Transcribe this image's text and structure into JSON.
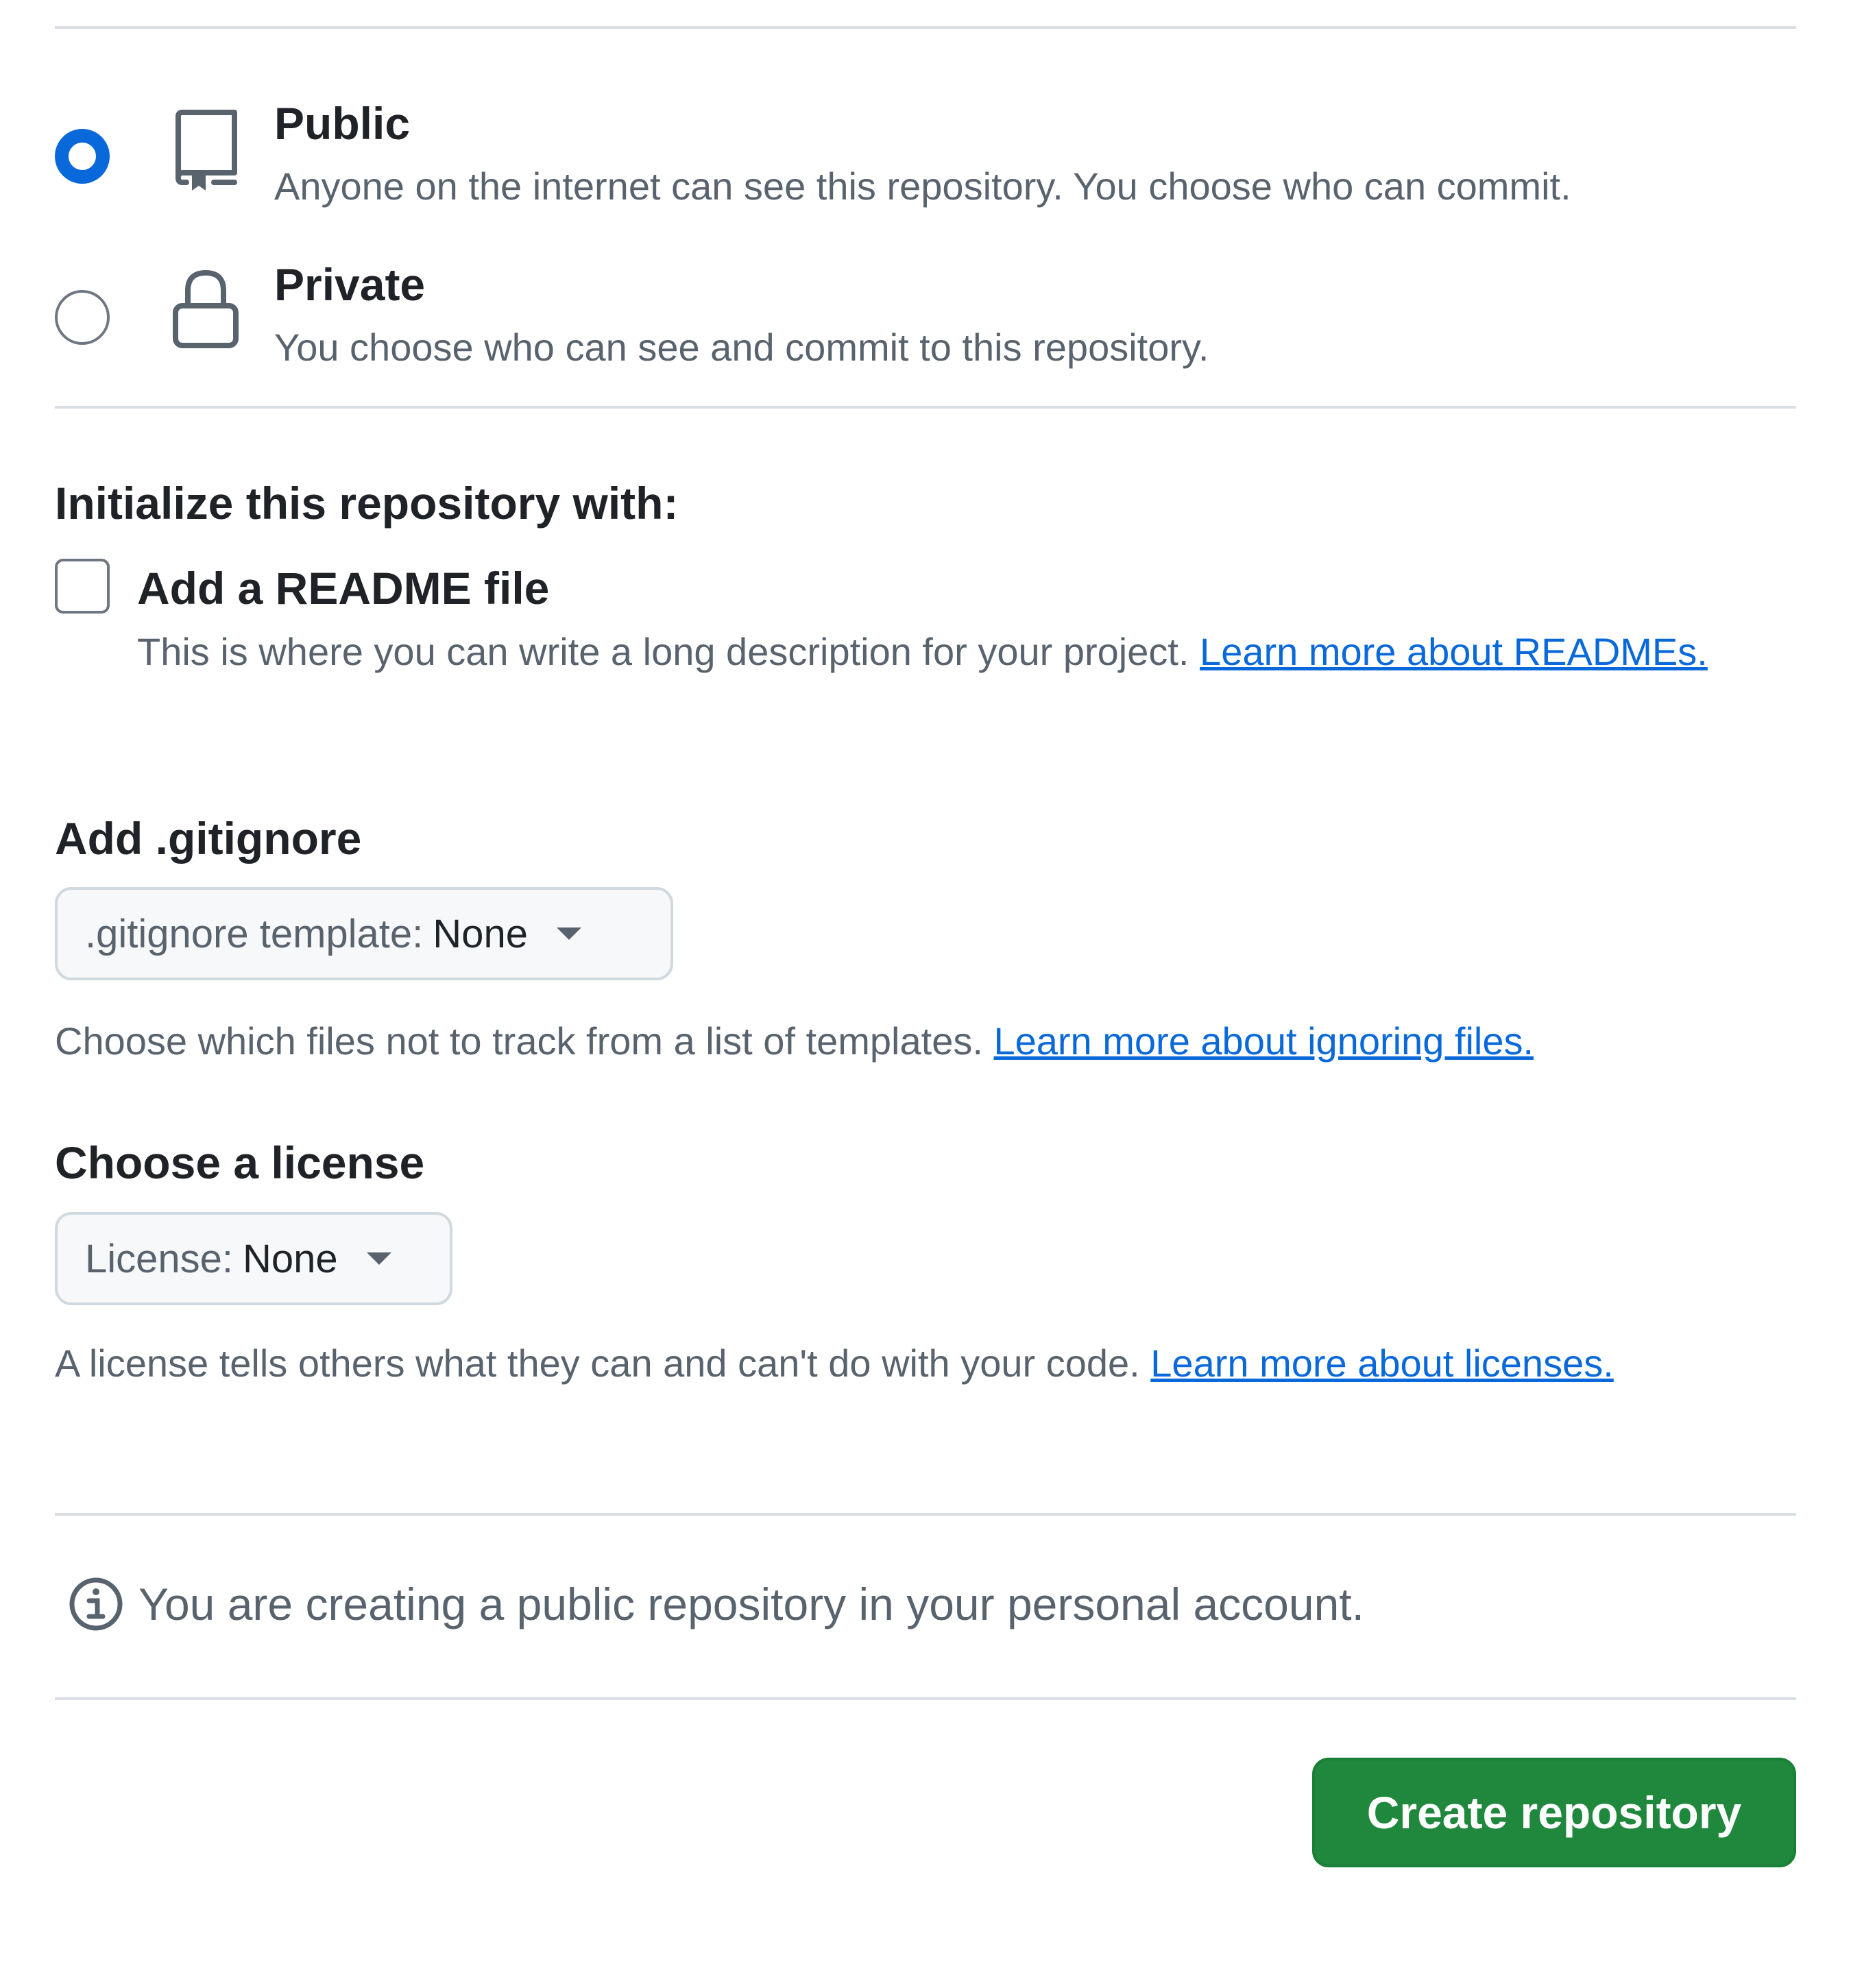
{
  "visibility": {
    "public": {
      "title": "Public",
      "description": "Anyone on the internet can see this repository. You choose who can commit.",
      "selected": true,
      "icon": "repo-icon"
    },
    "private": {
      "title": "Private",
      "description": "You choose who can see and commit to this repository.",
      "selected": false,
      "icon": "lock-icon"
    }
  },
  "initialize": {
    "heading": "Initialize this repository with:",
    "readme": {
      "label": "Add a README file",
      "checked": false,
      "description": "This is where you can write a long description for your project.",
      "link": "Learn more about READMEs."
    }
  },
  "gitignore": {
    "heading": "Add .gitignore",
    "dropdown_label": ".gitignore template:",
    "dropdown_value": "None",
    "description": "Choose which files not to track from a list of templates.",
    "link": "Learn more about ignoring files."
  },
  "license": {
    "heading": "Choose a license",
    "dropdown_label": "License:",
    "dropdown_value": "None",
    "description": "A license tells others what they can and can't do with your code.",
    "link": "Learn more about licenses."
  },
  "notice": {
    "icon": "info-icon",
    "text": "You are creating a public repository in your personal account."
  },
  "actions": {
    "create_label": "Create repository"
  },
  "colors": {
    "accent": "#0969da",
    "primary_button": "#1f883d",
    "muted_text": "#59636e"
  }
}
